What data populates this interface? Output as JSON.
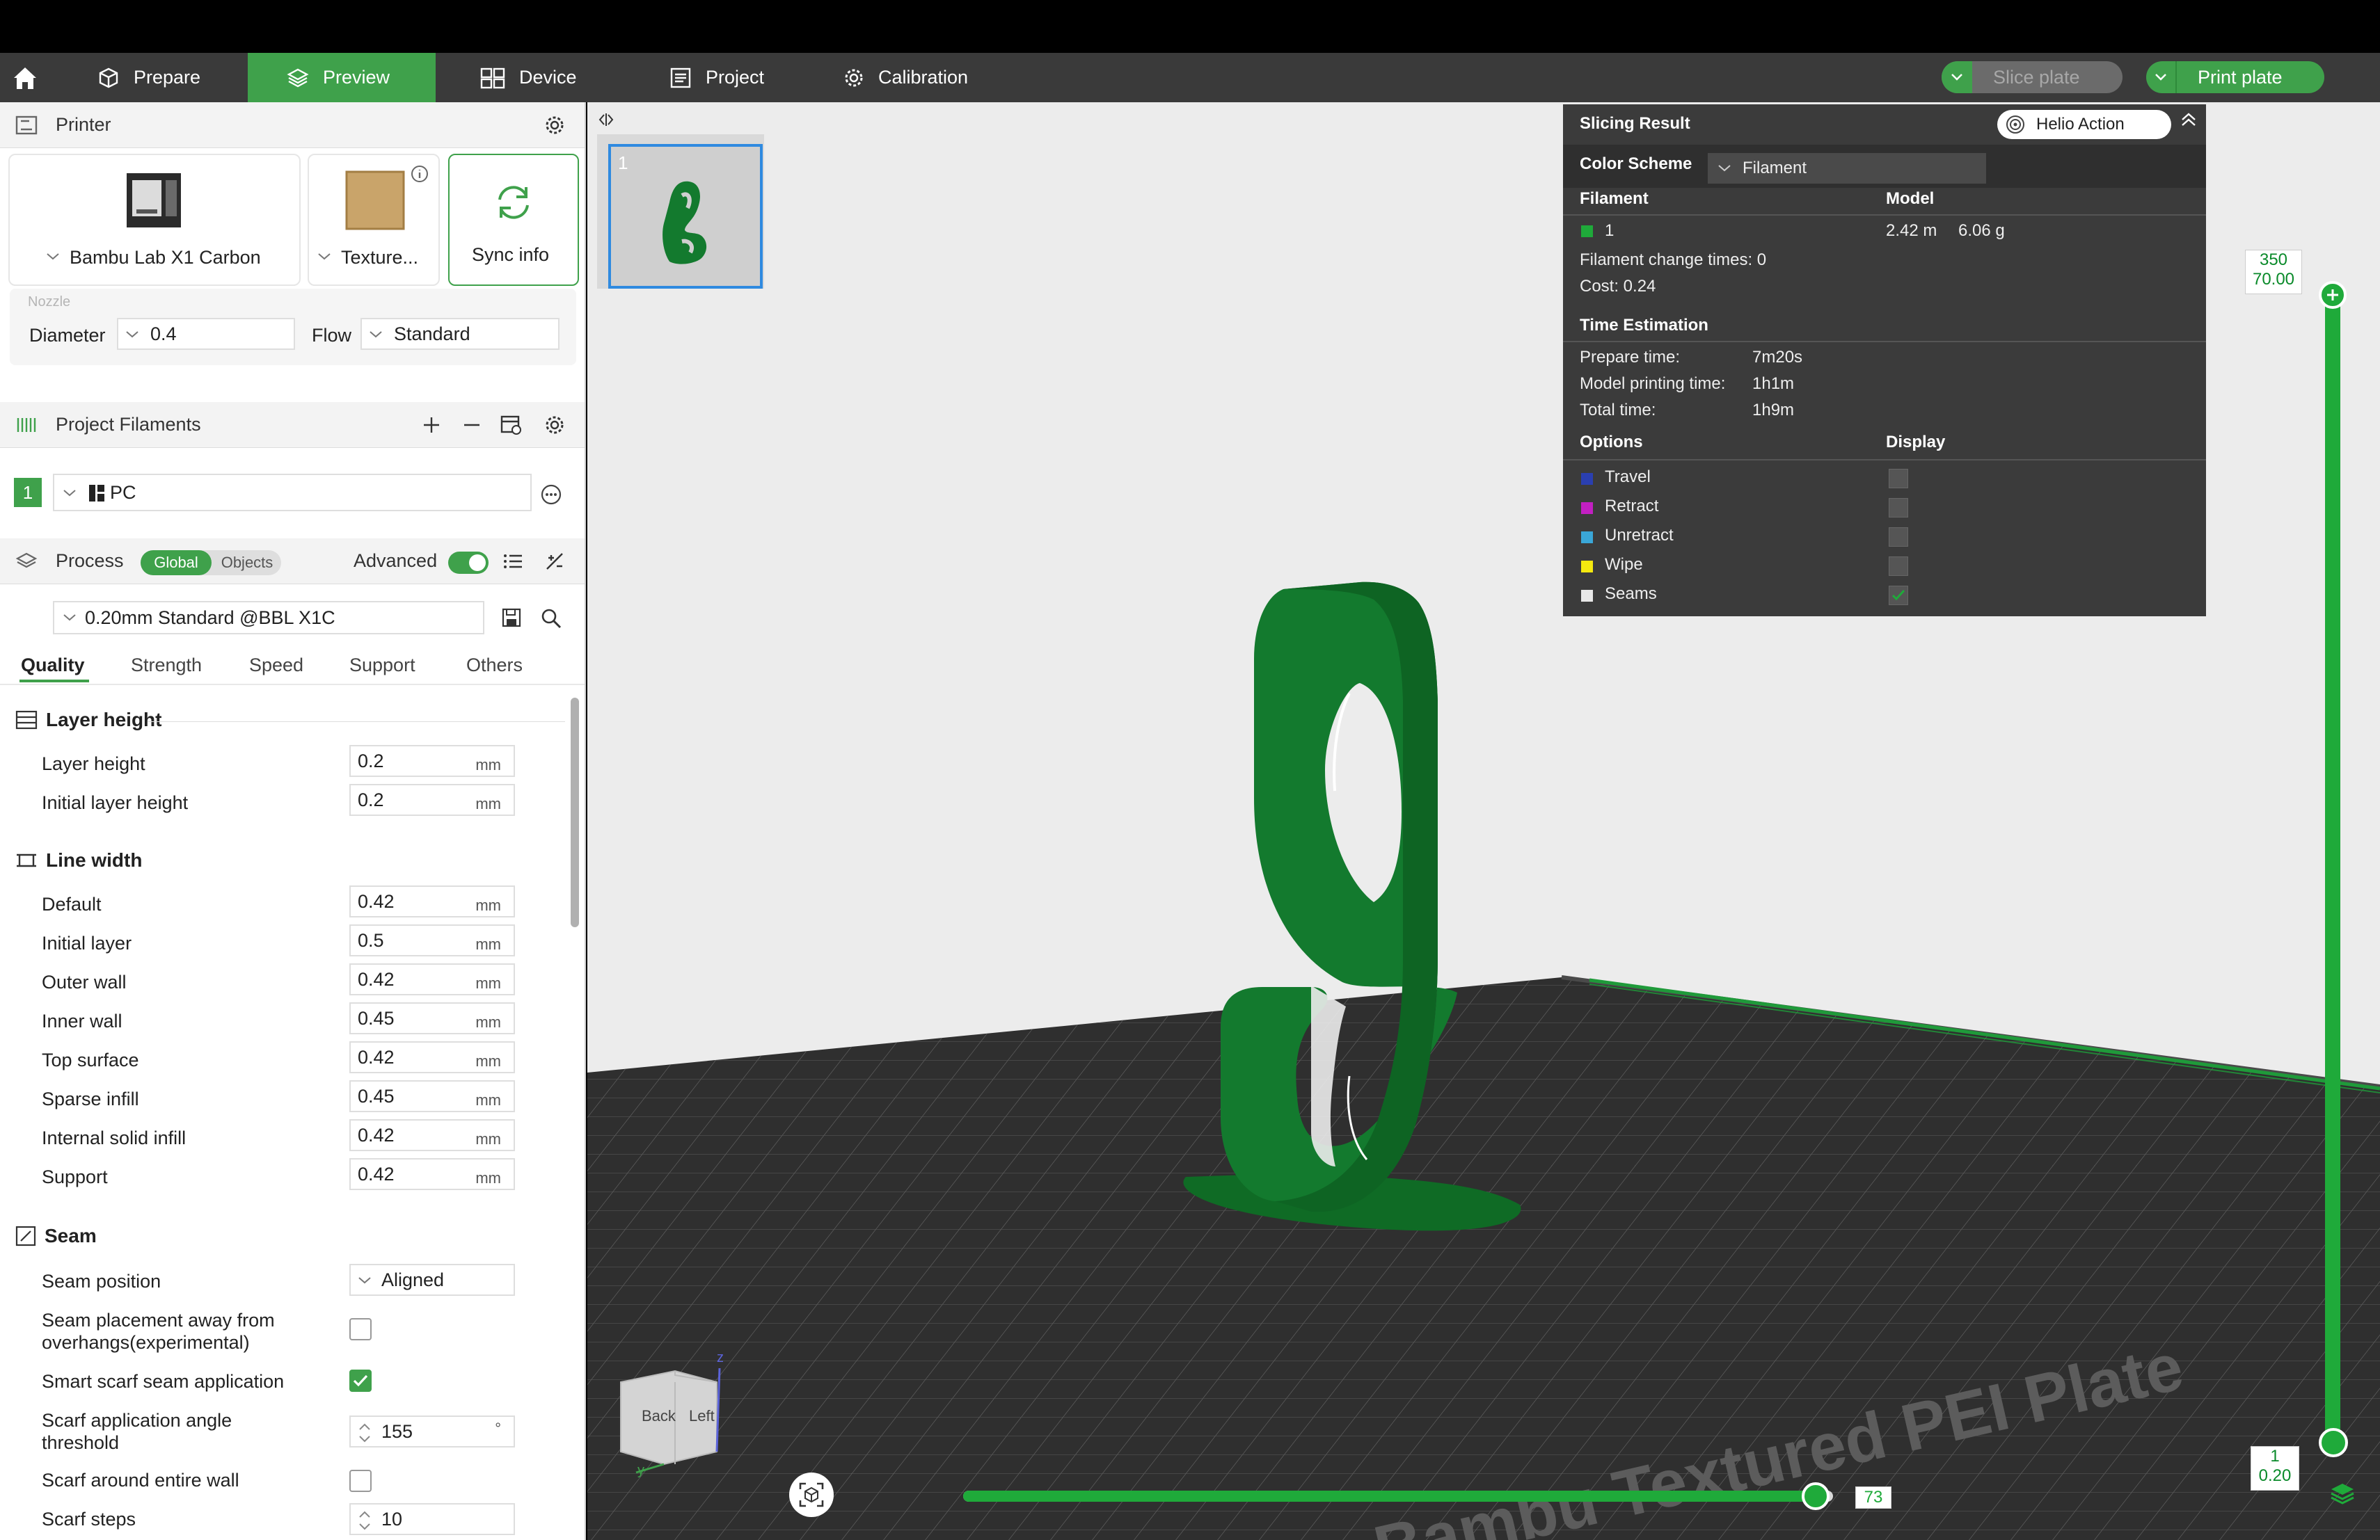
{
  "nav": {
    "tabs": [
      {
        "label": "Prepare"
      },
      {
        "label": "Preview"
      },
      {
        "label": "Device"
      },
      {
        "label": "Project"
      },
      {
        "label": "Calibration"
      }
    ],
    "slice_label": "Slice plate",
    "print_label": "Print plate"
  },
  "printer": {
    "section_title": "Printer",
    "printer_name": "Bambu Lab X1 Carbon",
    "plate_name": "Texture...",
    "sync_label": "Sync info",
    "nozzle_label": "Nozzle",
    "diameter_label": "Diameter",
    "diameter_value": "0.4",
    "flow_label": "Flow",
    "flow_value": "Standard"
  },
  "filaments": {
    "section_title": "Project Filaments",
    "items": [
      {
        "index": "1",
        "name": "PC"
      }
    ]
  },
  "process": {
    "section_title": "Process",
    "toggle_global": "Global",
    "toggle_objects": "Objects",
    "advanced_label": "Advanced",
    "preset": "0.20mm Standard @BBL X1C",
    "tabs": [
      "Quality",
      "Strength",
      "Speed",
      "Support",
      "Others"
    ],
    "layer_height_group": "Layer height",
    "layer_height": [
      {
        "label": "Layer height",
        "value": "0.2",
        "unit": "mm"
      },
      {
        "label": "Initial layer height",
        "value": "0.2",
        "unit": "mm"
      }
    ],
    "line_width_group": "Line width",
    "line_width": [
      {
        "label": "Default",
        "value": "0.42",
        "unit": "mm"
      },
      {
        "label": "Initial layer",
        "value": "0.5",
        "unit": "mm"
      },
      {
        "label": "Outer wall",
        "value": "0.42",
        "unit": "mm"
      },
      {
        "label": "Inner wall",
        "value": "0.45",
        "unit": "mm"
      },
      {
        "label": "Top surface",
        "value": "0.42",
        "unit": "mm"
      },
      {
        "label": "Sparse infill",
        "value": "0.45",
        "unit": "mm"
      },
      {
        "label": "Internal solid infill",
        "value": "0.42",
        "unit": "mm"
      },
      {
        "label": "Support",
        "value": "0.42",
        "unit": "mm"
      }
    ],
    "seam_group": "Seam",
    "seam_position_label": "Seam position",
    "seam_position_value": "Aligned",
    "seam_away_label_1": "Seam placement away from",
    "seam_away_label_2": "overhangs(experimental)",
    "smart_scarf_label": "Smart scarf seam application",
    "scarf_angle_label_1": "Scarf application angle",
    "scarf_angle_label_2": "threshold",
    "scarf_angle_value": "155",
    "scarf_angle_unit": "°",
    "scarf_entire_label": "Scarf around entire wall",
    "scarf_steps_label": "Scarf steps",
    "scarf_steps_value": "10"
  },
  "plate_thumb": {
    "number": "1"
  },
  "slicing": {
    "title": "Slicing Result",
    "helio_label": "Helio Action",
    "color_scheme_label": "Color Scheme",
    "color_scheme_value": "Filament",
    "col_filament": "Filament",
    "col_model": "Model",
    "filament_index": "1",
    "filament_length": "2.42 m",
    "filament_weight": "6.06 g",
    "change_times": "Filament change times:  0",
    "cost": "Cost:  0.24",
    "time_title": "Time Estimation",
    "prepare_label": "Prepare time:",
    "prepare_value": "7m20s",
    "model_time_label": "Model printing time:",
    "model_time_value": "1h1m",
    "total_label": "Total time:",
    "total_value": "1h9m",
    "options_title": "Options",
    "display_title": "Display",
    "options": [
      {
        "label": "Travel",
        "color": "#2a3fb0",
        "checked": false
      },
      {
        "label": "Retract",
        "color": "#c21fc2",
        "checked": false
      },
      {
        "label": "Unretract",
        "color": "#3aa7d8",
        "checked": false
      },
      {
        "label": "Wipe",
        "color": "#f5e90f",
        "checked": false
      },
      {
        "label": "Seams",
        "color": "#e8e8e8",
        "checked": true
      }
    ]
  },
  "layer_slider": {
    "top_layer": "350",
    "top_height": "70.00",
    "bottom_layer": "1",
    "bottom_height": "0.20"
  },
  "move_slider": {
    "value": "73",
    "fraction": 0.98
  },
  "view_cube": {
    "back": "Back",
    "left": "Left",
    "axis_z": "z",
    "axis_y": "y"
  },
  "plate_text": "Bambu Textured PEI Plate",
  "colors": {
    "accent": "#3fa14b",
    "model": "#137a2e",
    "bed": "#3a3a3a"
  }
}
